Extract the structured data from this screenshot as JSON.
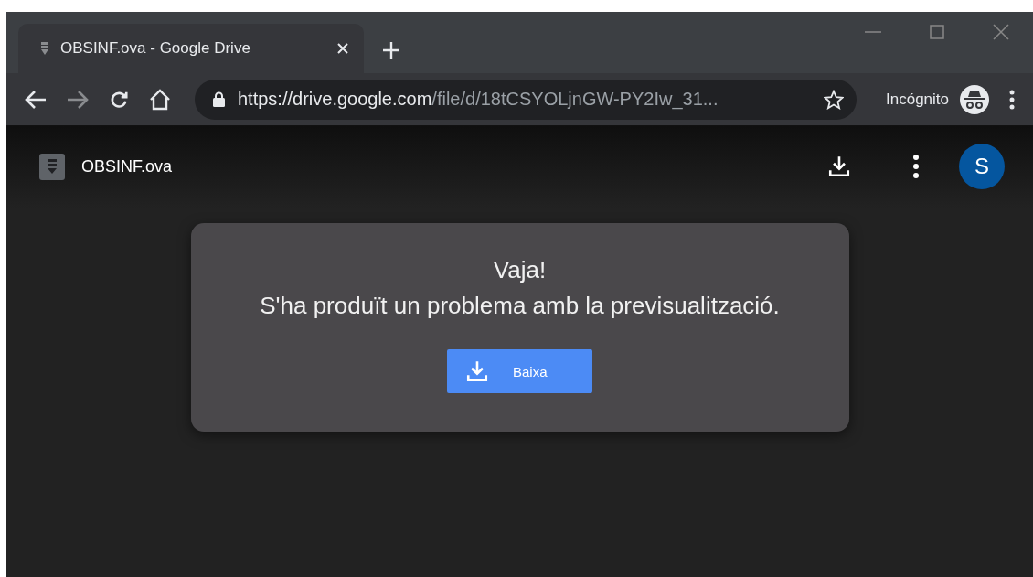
{
  "tabs": [
    {
      "title": "OBSINF.ova - Google Drive",
      "selected": true
    }
  ],
  "address_bar": {
    "host": "https://drive.google.com",
    "path": "/file/d/18tCSYOLjnGW-PY2Iw_31...",
    "starred": false
  },
  "profile": {
    "label": "Incógnito"
  },
  "viewer": {
    "file_name": "OBSINF.ova",
    "avatar_letter": "S"
  },
  "error_card": {
    "title": "Vaja!",
    "message": "S'ha produït un problema amb la previsualització.",
    "button": "Baixa"
  }
}
